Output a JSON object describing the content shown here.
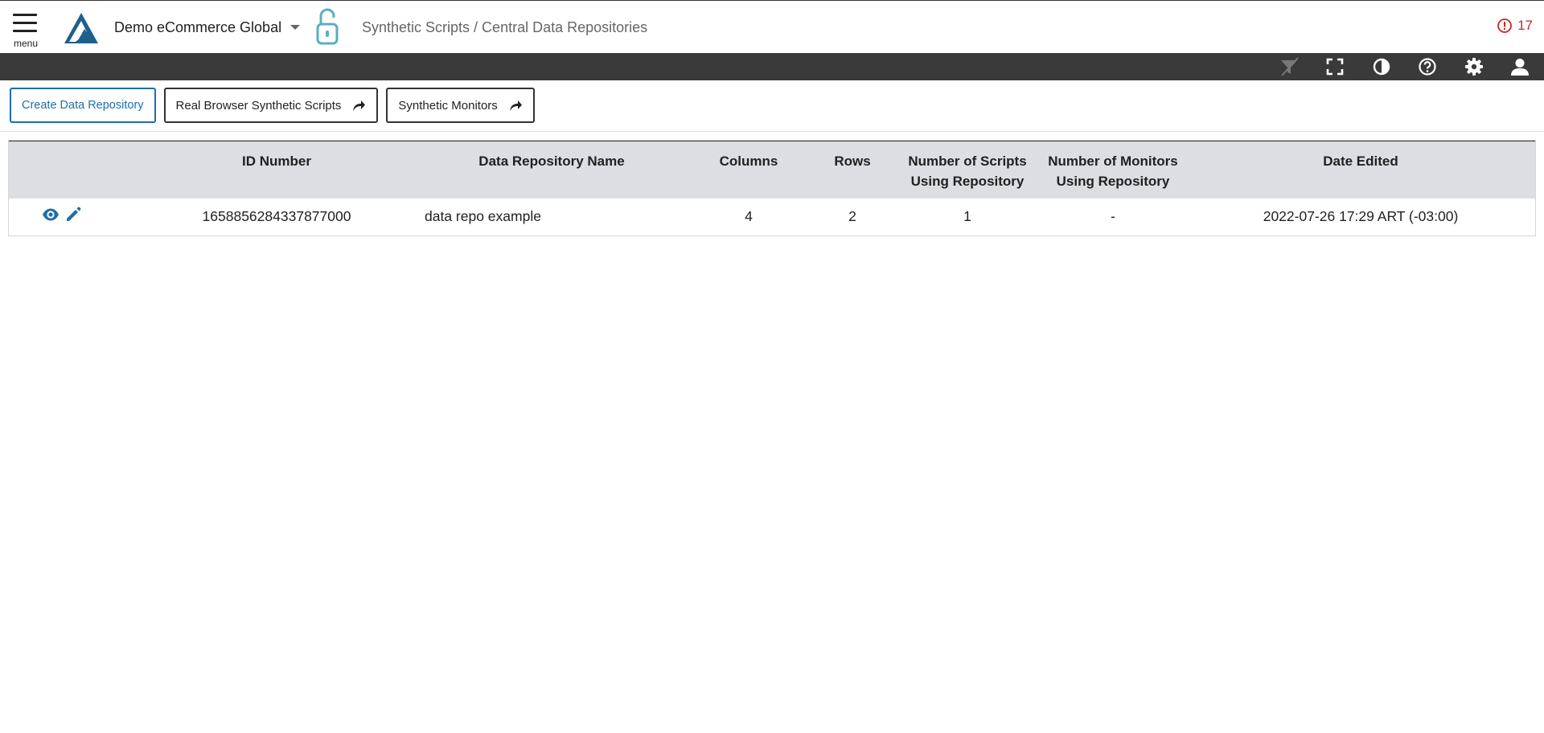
{
  "header": {
    "menu_label": "menu",
    "tenant_name": "Demo eCommerce Global",
    "breadcrumb": "Synthetic Scripts / Central Data Repositories",
    "alert_count": "17",
    "icons": {
      "menu": "hamburger-icon",
      "logo": "triangle-logo",
      "lock": "unlock-icon",
      "alert": "exclamation-circle-icon"
    }
  },
  "toolbar": {
    "icons": [
      "filter-icon",
      "fullscreen-icon",
      "contrast-icon",
      "help-icon",
      "gear-icon",
      "user-icon"
    ]
  },
  "actions": {
    "create_label": "Create Data Repository",
    "rb_scripts_label": "Real Browser Synthetic Scripts",
    "monitors_label": "Synthetic Monitors"
  },
  "table": {
    "headers": {
      "id": "ID Number",
      "name": "Data Repository Name",
      "columns": "Columns",
      "rows": "Rows",
      "scripts_line1": "Number of Scripts",
      "scripts_line2": "Using Repository",
      "monitors_line1": "Number of Monitors",
      "monitors_line2": "Using Repository",
      "date": "Date Edited"
    },
    "rows": [
      {
        "id": "1658856284337877000",
        "name": "data repo example",
        "columns": "4",
        "rows": "2",
        "scripts": "1",
        "monitors": "-",
        "date": "2022-07-26 17:29 ART (-03:00)"
      }
    ]
  },
  "colors": {
    "accent": "#1e6fa8",
    "alert": "#c62828",
    "toolbar_bg": "#3a3a3a",
    "table_header_bg": "#dcdee1",
    "logo": "#1f5f8b",
    "lock": "#5aaec0"
  }
}
